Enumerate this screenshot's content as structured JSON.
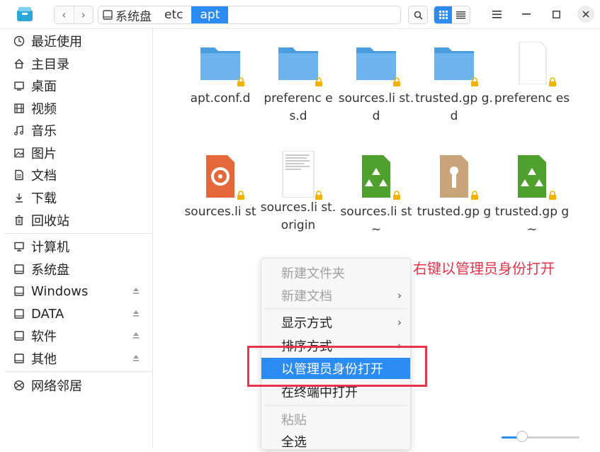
{
  "toolbar": {
    "app_icon": "file-manager-icon",
    "back_icon": "chevron-left-icon",
    "forward_icon": "chevron-right-icon",
    "breadcrumb": {
      "disk_label": "系统盘",
      "items": [
        "etc",
        "apt"
      ],
      "active_index": 1
    },
    "search_icon": "search-icon",
    "view_icons": [
      "icon-view-icon",
      "list-view-icon"
    ],
    "window_icons": [
      "menu-icon",
      "minimize-icon",
      "maximize-icon",
      "close-icon"
    ]
  },
  "sidebar": {
    "items": [
      {
        "label": "最近使用",
        "icon": "clock-icon"
      },
      {
        "label": "主目录",
        "icon": "home-icon"
      },
      {
        "label": "桌面",
        "icon": "desktop-icon"
      },
      {
        "label": "视频",
        "icon": "video-icon"
      },
      {
        "label": "音乐",
        "icon": "music-icon"
      },
      {
        "label": "图片",
        "icon": "picture-icon"
      },
      {
        "label": "文档",
        "icon": "document-icon"
      },
      {
        "label": "下载",
        "icon": "download-icon"
      },
      {
        "label": "回收站",
        "icon": "trash-icon"
      },
      {
        "label": "计算机",
        "icon": "computer-icon"
      },
      {
        "label": "系统盘",
        "icon": "drive-icon"
      },
      {
        "label": "Windows",
        "icon": "drive-icon",
        "eject": true
      },
      {
        "label": "DATA",
        "icon": "drive-icon",
        "eject": true
      },
      {
        "label": "软件",
        "icon": "drive-icon",
        "eject": true
      },
      {
        "label": "其他",
        "icon": "drive-icon",
        "eject": true
      },
      {
        "label": "网络邻居",
        "icon": "network-icon"
      }
    ]
  },
  "files": [
    {
      "name": "apt.conf.d",
      "type": "folder"
    },
    {
      "name": "preferenc es.d",
      "type": "folder"
    },
    {
      "name": "sources.li st.d",
      "type": "folder"
    },
    {
      "name": "trusted.gp g.d",
      "type": "folder"
    },
    {
      "name": "preferenc es",
      "type": "blank"
    },
    {
      "name": "sources.li st",
      "type": "orange"
    },
    {
      "name": "sources.li st.origin",
      "type": "text"
    },
    {
      "name": "sources.li st~",
      "type": "recycle"
    },
    {
      "name": "trusted.gp g",
      "type": "key"
    },
    {
      "name": "trusted.gp g~",
      "type": "recycle"
    }
  ],
  "context_menu": {
    "items": [
      {
        "label": "新建文件夹",
        "disabled": true
      },
      {
        "label": "新建文档",
        "disabled": true,
        "submenu": true
      },
      {
        "label": "显示方式",
        "submenu": true
      },
      {
        "label": "排序方式",
        "submenu": true
      },
      {
        "label": "以管理员身份打开",
        "highlighted": true
      },
      {
        "label": "在终端中打开"
      },
      {
        "label": "粘贴",
        "disabled": true
      },
      {
        "label": "全选"
      }
    ],
    "submenu_arrow": "›"
  },
  "annotation": "右键以管理员身份打开",
  "zoom": {
    "level": 0.25
  },
  "colors": {
    "accent": "#2a8bf2",
    "folder": "#6cb3ef",
    "annotation": "#e8334a"
  }
}
